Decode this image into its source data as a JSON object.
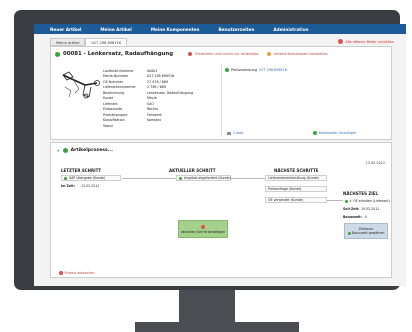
{
  "nav": {
    "items": [
      "Neuer Artikel",
      "Meine Artikel",
      "Meine Komponenten",
      "Benutzerzeiten",
      "Administration"
    ]
  },
  "tabs": [
    {
      "label": "Meine Artikel",
      "active": false
    },
    {
      "label": "027 298 698Y16",
      "active": true
    }
  ],
  "close_all_label": "Alle offenen Reiter schließen",
  "article": {
    "title": "00081 - Lenkersatz, Radaufhängung",
    "delete_label": "Entwickeln und zurück zur Artikelliste",
    "edit_label": "Artikelinformationen bearbeiten",
    "properties": [
      {
        "key": "Laufende Nummer",
        "value": "00001"
      },
      {
        "key": "Meyle-Nummer",
        "value": "027 298 698Y16"
      },
      {
        "key": "OE-Nummer",
        "value": "27 978 / 689"
      },
      {
        "key": "Lieferantennummer",
        "value": "2 798 / 689"
      },
      {
        "key": "Bezeichnung",
        "value": "Lenkersatz, Radaufhängung"
      },
      {
        "key": "Kunde",
        "value": "Meyle"
      },
      {
        "key": "Lieferant",
        "value": "SAO"
      },
      {
        "key": "Einbauseite",
        "value": "Rechts"
      },
      {
        "key": "Produktgruppe",
        "value": "Fahrwerk"
      },
      {
        "key": "Klassifikation",
        "value": "Komplex"
      },
      {
        "key": "Stand",
        "value": ""
      }
    ],
    "price_label": "Preiszuweisung",
    "price_value": "027 298 698Y16",
    "files_label": "2 Akte",
    "comment_label": "Kommentar hinzufügen"
  },
  "process": {
    "header": "Artikelprozess...",
    "date": "13.02.2012",
    "last_step": {
      "title": "LETZTER SCHRITT",
      "value": "SAP Übergabe (Kunde)",
      "date_label": "Im Zeit:",
      "date_value": "13.02.2012"
    },
    "current_step": {
      "title": "AKTUELLER SCHRITT",
      "value": "Angebot abgefordert (Kunde)",
      "button_label": "aktuellen Schritt bestätigen"
    },
    "next_steps": {
      "title": "NÄCHSTE SCHRITTE",
      "steps": [
        "Lieferantenentwicklung (Kunde)",
        "Preisanfrage (Kunde)",
        "OE versendet (Kunde)"
      ]
    },
    "next_goal": {
      "title": "NÄCHSTES ZIEL",
      "value": "OE erhalten (Lieferant)",
      "soll_label": "Soll-Zeit:",
      "soll_value": "19.02.2012",
      "bonus_label": "Bonuszeit:",
      "bonus_value": "0",
      "button_line1": "Zeitraum",
      "button_line2": "Bonuszeit gewähren"
    },
    "abort_label": "Prozess abbrechen"
  },
  "colors": {
    "nav": "#1d5a98",
    "accent_green": "#3aa43a",
    "accent_red": "#d9534f",
    "link_blue": "#2f6fb3"
  }
}
